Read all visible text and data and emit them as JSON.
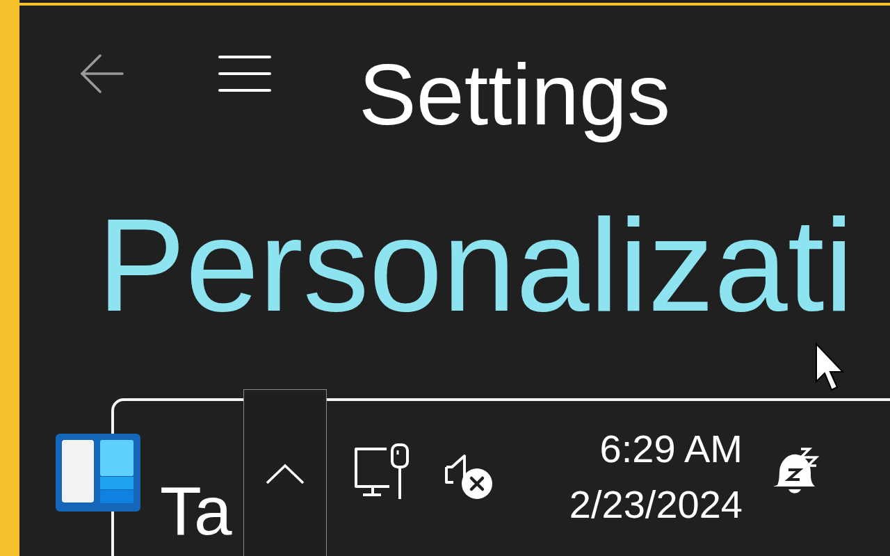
{
  "window": {
    "title": "Settings"
  },
  "page": {
    "heading": "Personalizati"
  },
  "card": {
    "heading": "Ta"
  },
  "taskbar": {
    "time": "6:29 AM",
    "date": "2/23/2024"
  }
}
